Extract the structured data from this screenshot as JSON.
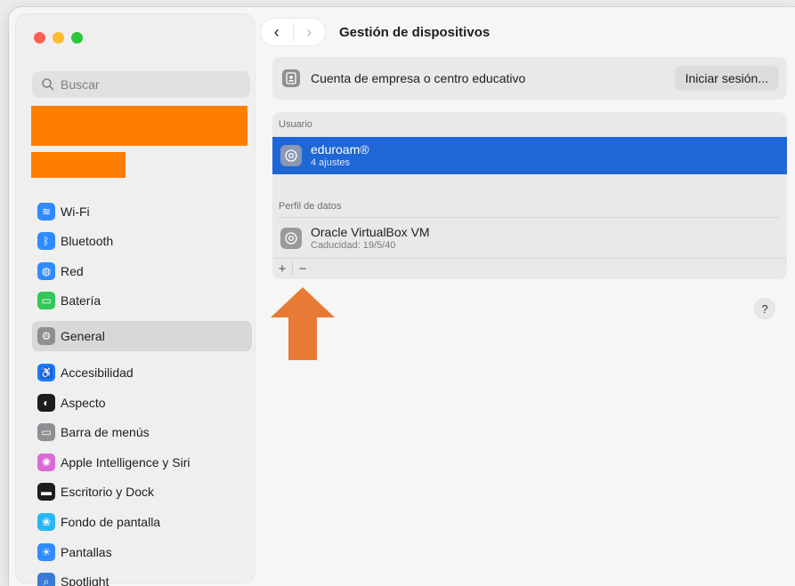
{
  "search": {
    "placeholder": "Buscar"
  },
  "sidebar": {
    "items": [
      {
        "label": "Wi-Fi",
        "icon": "wifi-icon",
        "color": "#2f8bff",
        "glyph": "≋"
      },
      {
        "label": "Bluetooth",
        "icon": "bluetooth-icon",
        "color": "#2f8bff",
        "glyph": "ᛒ"
      },
      {
        "label": "Red",
        "icon": "globe-icon",
        "color": "#2f8bff",
        "glyph": "◍"
      },
      {
        "label": "Batería",
        "icon": "battery-icon",
        "color": "#34c759",
        "glyph": "▭"
      },
      {
        "label": "General",
        "icon": "gear-icon",
        "color": "#8e8e93",
        "glyph": "⚙"
      },
      {
        "label": "Accesibilidad",
        "icon": "accessibility-icon",
        "color": "#1a7cf5",
        "glyph": "♿"
      },
      {
        "label": "Aspecto",
        "icon": "appearance-icon",
        "color": "#1d1d1f",
        "glyph": "◐"
      },
      {
        "label": "Barra de menús",
        "icon": "menubar-icon",
        "color": "#8e8e93",
        "glyph": "▭"
      },
      {
        "label": "Apple Intelligence y Siri",
        "icon": "siri-icon",
        "color": "#d96ad6",
        "glyph": "✺"
      },
      {
        "label": "Escritorio y Dock",
        "icon": "dock-icon",
        "color": "#1d1d1f",
        "glyph": "▬"
      },
      {
        "label": "Fondo de pantalla",
        "icon": "wallpaper-icon",
        "color": "#29b6f6",
        "glyph": "❀"
      },
      {
        "label": "Pantallas",
        "icon": "displays-icon",
        "color": "#2f8bff",
        "glyph": "☀"
      },
      {
        "label": "Spotlight",
        "icon": "spotlight-icon",
        "color": "#3a7bd5",
        "glyph": "⌕"
      }
    ],
    "selected_label": "General"
  },
  "header": {
    "title": "Gestión de dispositivos"
  },
  "account": {
    "label": "Cuenta de empresa o centro educativo",
    "button": "Iniciar sesión..."
  },
  "profiles": {
    "user_section": "Usuario",
    "user_items": [
      {
        "name": "eduroam®",
        "detail": "4 ajustes"
      }
    ],
    "data_section": "Perfil de datos",
    "data_items": [
      {
        "name": "Oracle VirtualBox VM",
        "detail": "Caducidad: 19/5/40"
      }
    ],
    "add": "+",
    "remove": "−"
  },
  "help": "?",
  "colors": {
    "accent": "#1f66d6",
    "redaction": "#ff7e00",
    "arrow": "#e87a35"
  }
}
